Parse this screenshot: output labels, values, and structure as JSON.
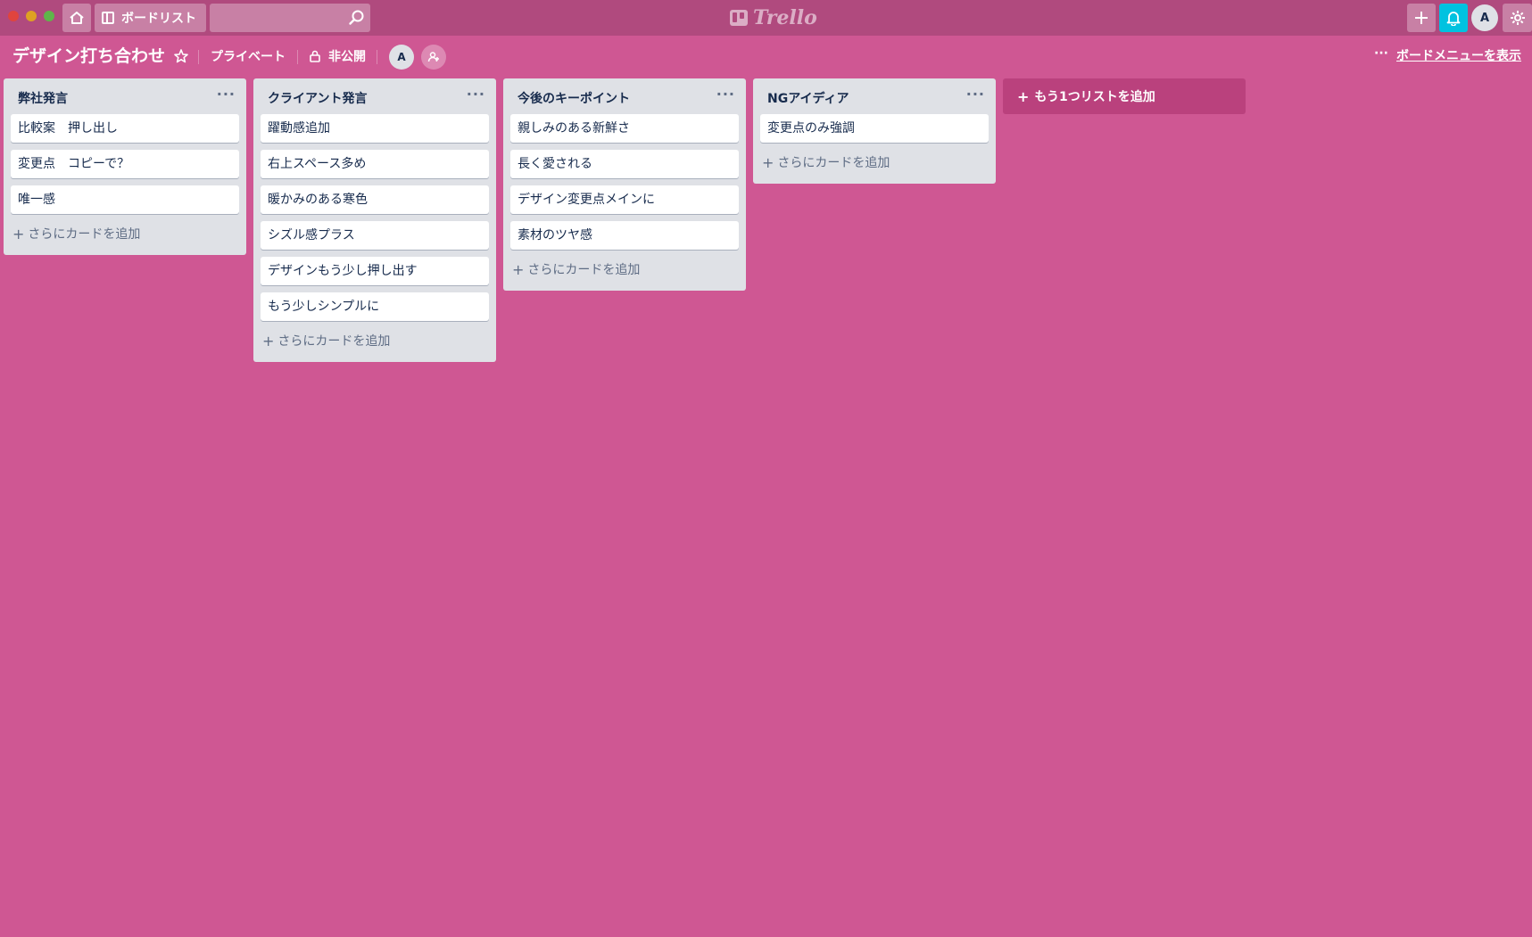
{
  "header": {
    "boards_label": "ボードリスト",
    "search_placeholder": "",
    "logo_text": "Trello",
    "avatar_initial": "A",
    "icons": [
      "home-icon",
      "board-icon",
      "search-icon",
      "trello-logo-icon",
      "plus-icon",
      "bell-icon",
      "gear-icon"
    ]
  },
  "board": {
    "title": "デザイン打ち合わせ",
    "visibility_label": "プライベート",
    "privacy_label": "非公開",
    "member_initial": "A",
    "more_label": "···",
    "menu_label": "ボードメニューを表示"
  },
  "lists": [
    {
      "title": "弊社発言",
      "cards": [
        "比較案　押し出し",
        "変更点　コピーで？",
        "唯一感"
      ],
      "add_label": "さらにカードを追加"
    },
    {
      "title": "クライアント発言",
      "cards": [
        "躍動感追加",
        "右上スペース多め",
        "暖かみのある寒色",
        "シズル感プラス",
        "デザインもう少し押し出す",
        "もう少しシンプルに"
      ],
      "add_label": "さらにカードを追加"
    },
    {
      "title": "今後のキーポイント",
      "cards": [
        "親しみのある新鮮さ",
        "長く愛される",
        "デザイン変更点メインに",
        "素材のツヤ感"
      ],
      "add_label": "さらにカードを追加"
    },
    {
      "title": "NGアイディア",
      "cards": [
        "変更点のみ強調"
      ],
      "add_label": "さらにカードを追加"
    }
  ],
  "add_list_label": "もう1つリストを追加",
  "colors": {
    "background": "#cf5793",
    "header": "#b04a7e",
    "notification": "#00c2e0",
    "list": "#dfe1e6"
  }
}
